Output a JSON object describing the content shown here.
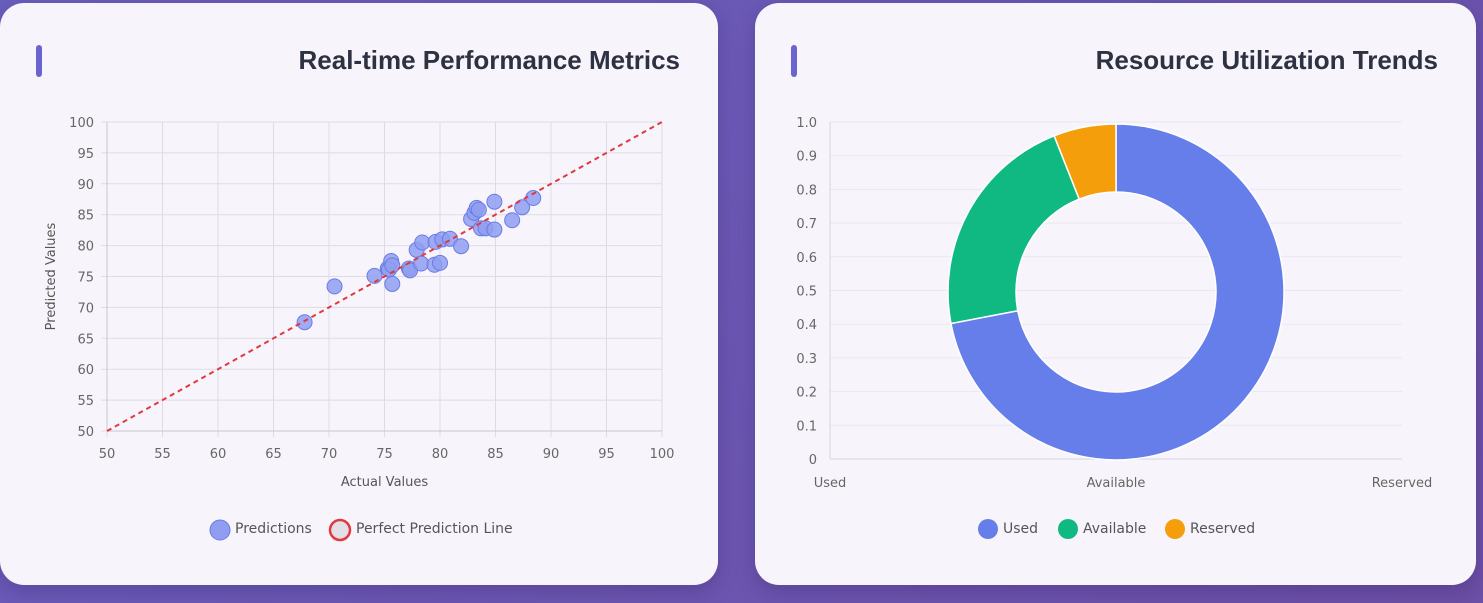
{
  "left_card": {
    "title": "Real-time Performance Metrics"
  },
  "right_card": {
    "title": "Resource Utilization Trends"
  },
  "colors": {
    "predictions_fill": "#8f9ef0",
    "predictions_stroke": "#6b7be5",
    "perfect_line": "#e0393e",
    "used": "#667eea",
    "available": "#10b981",
    "reserved": "#f59e0b"
  },
  "chart_data": [
    {
      "type": "scatter",
      "title": "",
      "xlabel": "Actual Values",
      "ylabel": "Predicted Values",
      "xlim": [
        50,
        100
      ],
      "ylim": [
        50,
        100
      ],
      "xticks": [
        50,
        55,
        60,
        65,
        70,
        75,
        80,
        85,
        90,
        95,
        100
      ],
      "yticks": [
        100,
        95,
        90,
        85,
        80,
        75,
        70,
        65,
        60,
        55,
        50
      ],
      "grid": true,
      "legend": "bottom",
      "series": [
        {
          "name": "Predictions",
          "x": [
            67.8,
            70.5,
            74.1,
            75.3,
            75.6,
            75.4,
            75.7,
            75.7,
            77.2,
            77.3,
            77.9,
            78.3,
            78.4,
            79.5,
            79.6,
            80.0,
            80.2,
            80.9,
            81.9,
            82.8,
            83.1,
            83.3,
            83.5,
            83.7,
            84.1,
            84.9,
            84.9,
            86.5,
            87.4,
            88.4
          ],
          "y": [
            67.6,
            73.4,
            75.1,
            76.3,
            77.5,
            76.1,
            73.8,
            76.8,
            76.3,
            76.0,
            79.3,
            77.1,
            80.5,
            76.9,
            80.6,
            77.2,
            81.0,
            81.1,
            79.9,
            84.3,
            85.3,
            86.1,
            85.8,
            82.8,
            82.8,
            87.1,
            82.6,
            84.1,
            86.2,
            87.7
          ]
        },
        {
          "name": "Perfect Prediction Line",
          "x": [
            50,
            100
          ],
          "y": [
            50,
            100
          ]
        }
      ]
    },
    {
      "type": "pie",
      "title": "",
      "categories": [
        "Used",
        "Available",
        "Reserved"
      ],
      "values": [
        72,
        22,
        6
      ],
      "ylim": [
        0,
        1.0
      ],
      "yticks": [
        1.0,
        0.9,
        0.8,
        0.7,
        0.6,
        0.5,
        0.4,
        0.3,
        0.2,
        0.1,
        0
      ],
      "xticks": [
        "Used",
        "Available",
        "Reserved"
      ],
      "grid": true,
      "legend": "bottom"
    }
  ]
}
